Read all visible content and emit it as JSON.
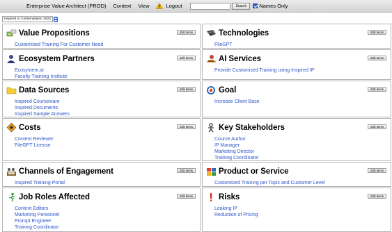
{
  "menubar": {
    "app_title": "Enterprise Value Architect (PROD)",
    "context": "Context",
    "view": "View",
    "logout": "Logout",
    "search_placeholder": "",
    "search_button": "Search",
    "names_only_label": "Names Only",
    "names_only_checked": true
  },
  "canvas_selector": {
    "value": "Inspired AI Contemplation 2023"
  },
  "edit_label": "Edit Items",
  "panels": [
    {
      "title": "Value Propositions",
      "icon": "value-propositions-icon",
      "items": [
        "Customised Training For Customer Need"
      ]
    },
    {
      "title": "Technologies",
      "icon": "technologies-icon",
      "items": [
        "FileGPT"
      ]
    },
    {
      "title": "Ecosystem Partners",
      "icon": "ecosystem-partners-icon",
      "items": [
        "Ecosystem.ai",
        "Faculty Training Institute"
      ]
    },
    {
      "title": "AI Services",
      "icon": "ai-services-icon",
      "items": [
        "Provide Customised Training using Inspired IP"
      ]
    },
    {
      "title": "Data Sources",
      "icon": "data-sources-icon",
      "items": [
        "Inspired Courseware",
        "Inspired Documents",
        "Inspired Sample Answers"
      ]
    },
    {
      "title": "Goal",
      "icon": "goal-icon",
      "items": [
        "Increase Client Base"
      ]
    },
    {
      "title": "Costs",
      "icon": "costs-icon",
      "items": [
        "Content Reviewer",
        "FileGPT License"
      ]
    },
    {
      "title": "Key Stakeholders",
      "icon": "key-stakeholders-icon",
      "items": [
        "Course Author",
        "IP Manager",
        "Marketing Director",
        "Training Coordinator"
      ]
    },
    {
      "title": "Channels of Engagement",
      "icon": "channels-of-engagement-icon",
      "items": [
        "Inspired Training Portal"
      ]
    },
    {
      "title": "Product or Service",
      "icon": "product-or-service-icon",
      "items": [
        "Customised Training per Topic and Customer Level"
      ]
    },
    {
      "title": "Job Roles Affected",
      "icon": "job-roles-affected-icon",
      "items": [
        "Content Editors",
        "Marketing Personnel",
        "Prompt Engineer",
        "Training Coordinator"
      ]
    },
    {
      "title": "Risks",
      "icon": "risks-icon",
      "items": [
        "Leaking IP",
        "Reduction of Pricing"
      ]
    }
  ]
}
